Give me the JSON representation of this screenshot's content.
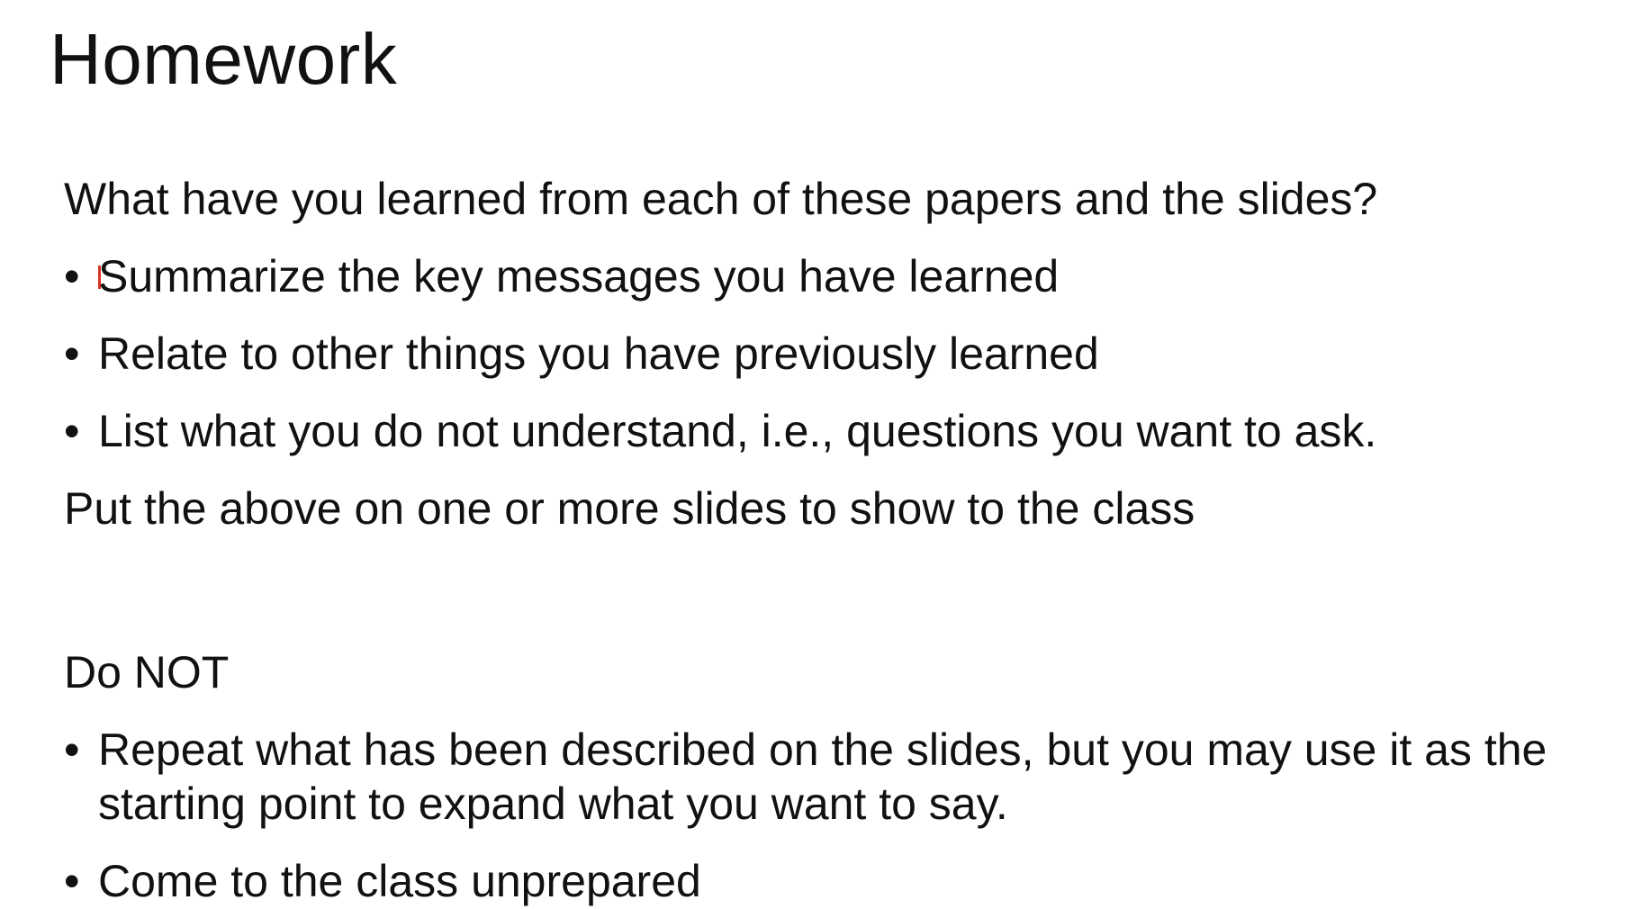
{
  "slide": {
    "title": "Homework",
    "intro": "What have you learned from each of these papers and the slides?",
    "learn_items": [
      "Summarize the key messages you have learned",
      "Relate to other things you have previously learned",
      "List what you do not understand, i.e., questions you want to ask."
    ],
    "instruction": "Put the above on one or more slides to show to the class",
    "do_not_heading": "Do NOT",
    "do_not_items": [
      "Repeat what has been described on the slides, but you may use it as the starting point to expand what you want to say.",
      "Come to the class unprepared"
    ],
    "bullet_symbol": "•"
  }
}
